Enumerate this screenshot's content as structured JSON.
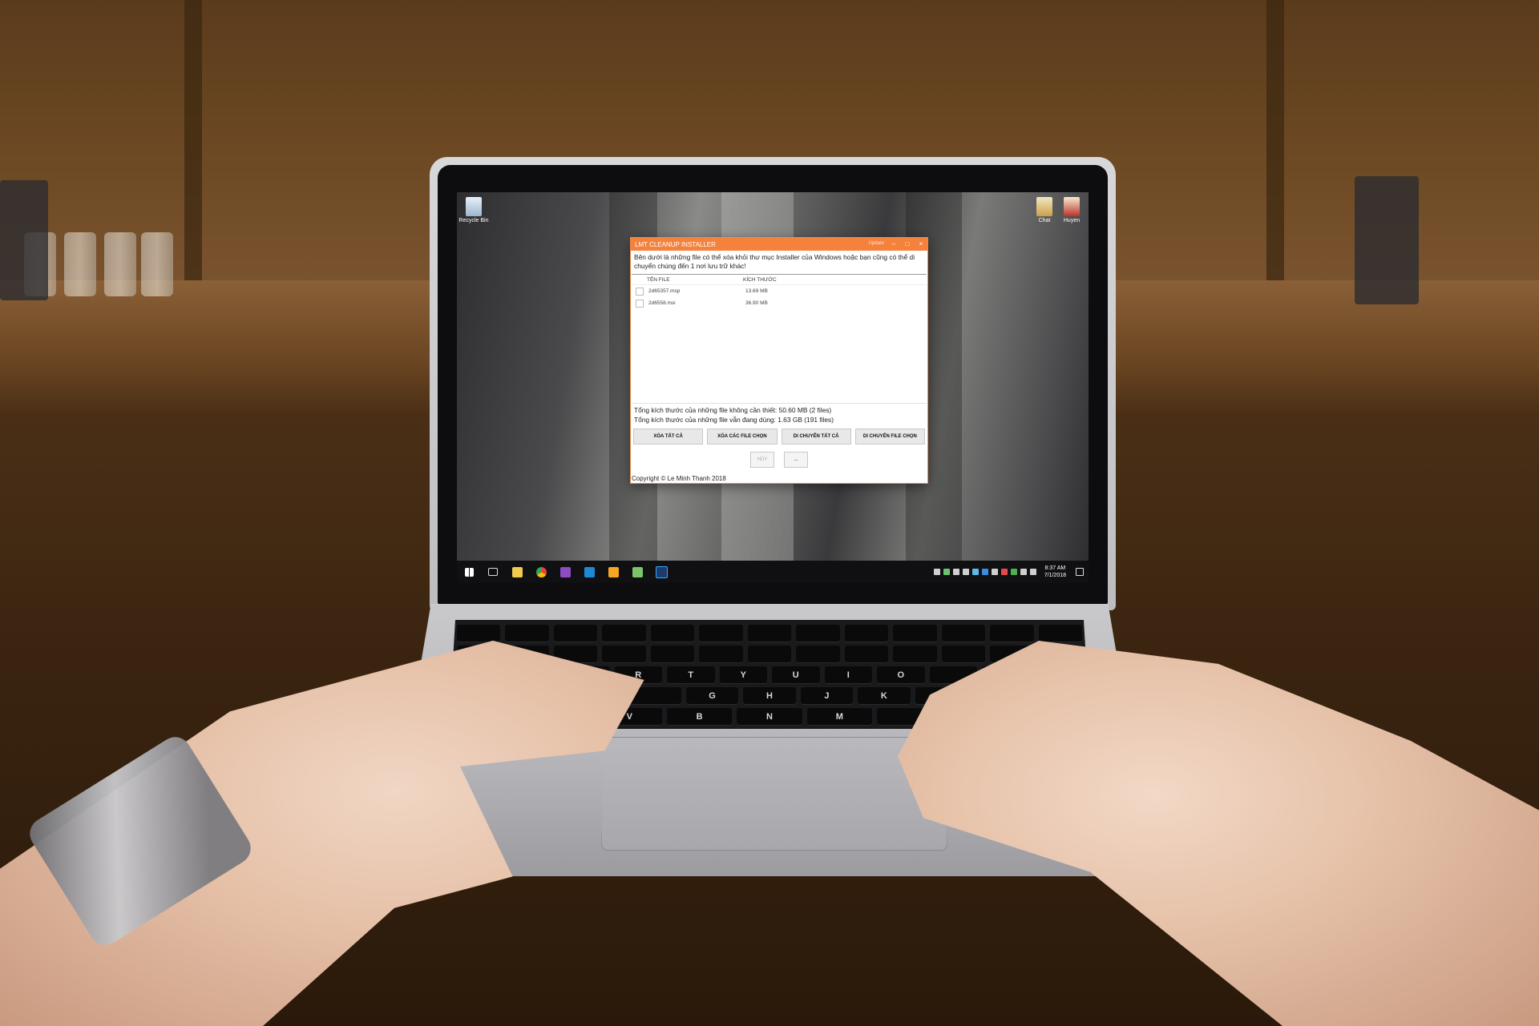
{
  "desktop": {
    "icons": [
      {
        "label": "Recycle Bin",
        "icon": "recycle-bin-icon"
      },
      {
        "label": "Chat",
        "icon": "document-icon"
      },
      {
        "label": "Huyen",
        "icon": "document-icon"
      }
    ]
  },
  "app": {
    "title": "LMT CLEANUP INSTALLER",
    "update_label": "Update",
    "description": "Bên dưới là những file có thể xóa khỏi thư mục Installer của Windows hoặc bạn cũng có thể di chuyển chúng đến 1 nơi lưu trữ khác!",
    "columns": {
      "name": "TÊN FILE",
      "size": "KÍCH THƯỚC"
    },
    "files": [
      {
        "name": "2d65357.msp",
        "size": "13.69 MB"
      },
      {
        "name": "2d6558.msi",
        "size": "36.90 MB"
      }
    ],
    "summary_unneeded": "Tổng kích thước của những file không cần thiết: 50.60 MB (2 files)",
    "summary_in_use": "Tổng kích thước của những file vẫn đang dùng: 1.63 GB (191 files)",
    "buttons": {
      "delete_all": "XÓA TẤT CẢ",
      "delete_selected": "XÓA CÁC FILE CHỌN",
      "move_all": "DI CHUYỂN TẤT CẢ",
      "move_selected": "DI CHUYỂN FILE CHỌN",
      "cancel": "HỦY",
      "browse": "..."
    },
    "copyright": "Copyright © Le Minh Thanh 2018"
  },
  "taskbar": {
    "apps": [
      "start-icon",
      "task-view-icon",
      "file-explorer-icon",
      "chrome-icon",
      "visual-studio-icon",
      "vscode-icon",
      "sublime-icon",
      "notepad-icon",
      "photoshop-icon"
    ],
    "time": "8:37 AM",
    "date": "7/1/2018"
  },
  "colors": {
    "title_bar": "#f4823d",
    "window_border": "#f08a4b",
    "taskbar": "#101012"
  }
}
